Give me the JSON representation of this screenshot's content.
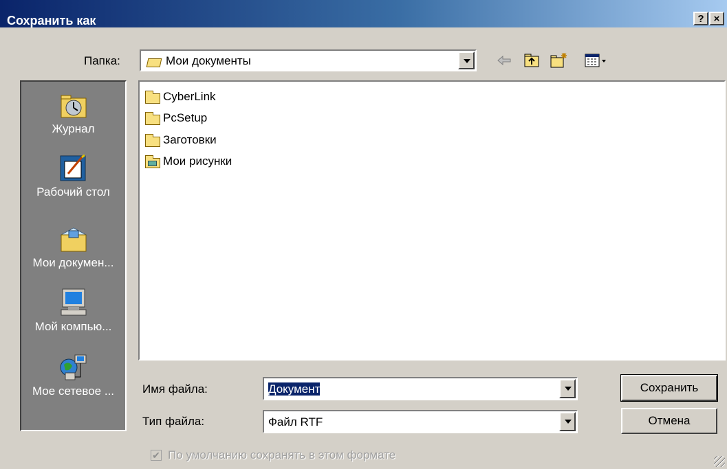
{
  "window": {
    "title": "Сохранить как",
    "help_button": "?",
    "close_button": "×"
  },
  "folder": {
    "label": "Папка:",
    "value": "Мои документы",
    "icons": [
      "back-arrow-icon",
      "up-folder-icon",
      "new-folder-icon",
      "view-menu-icon"
    ]
  },
  "places": [
    {
      "label": "Журнал",
      "icon": "history-icon"
    },
    {
      "label": "Рабочий стол",
      "icon": "desktop-icon"
    },
    {
      "label": "Мои докумен...",
      "icon": "my-documents-icon"
    },
    {
      "label": "Мой компью...",
      "icon": "my-computer-icon"
    },
    {
      "label": "Мое сетевое ...",
      "icon": "network-places-icon"
    }
  ],
  "files": [
    {
      "name": "CyberLink",
      "icon": "folder-icon"
    },
    {
      "name": "PcSetup",
      "icon": "folder-icon"
    },
    {
      "name": "Заготовки",
      "icon": "folder-icon"
    },
    {
      "name": "Мои рисунки",
      "icon": "pictures-folder-icon"
    }
  ],
  "filename": {
    "label": "Имя файла:",
    "value": "Документ"
  },
  "filetype": {
    "label": "Тип файла:",
    "value": "Файл RTF"
  },
  "buttons": {
    "save": "Сохранить",
    "cancel": "Отмена"
  },
  "default_format": {
    "label": "По умолчанию сохранять в этом формате",
    "checked": true,
    "mark": "✔"
  },
  "colors": {
    "titlebar_start": "#0a246a",
    "titlebar_end": "#a6caf0",
    "face": "#d4d0c8",
    "selection": "#0a246a"
  }
}
